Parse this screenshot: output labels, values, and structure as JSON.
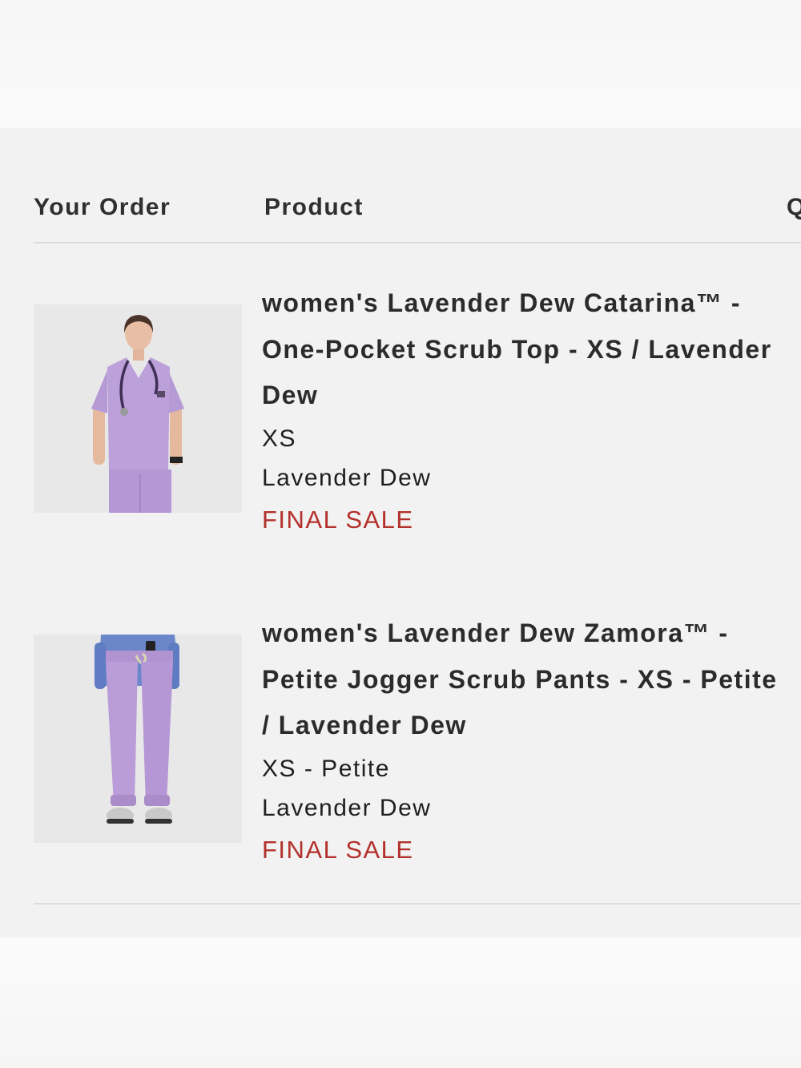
{
  "order_table": {
    "headers": {
      "your_order": "Your Order",
      "product": "Product",
      "quantity": "Q"
    },
    "items": [
      {
        "title": "women's Lavender Dew Catarina™ - One-Pocket Scrub Top - XS / Lavender Dew",
        "size": "XS",
        "color": "Lavender Dew",
        "sale_label": "FINAL SALE",
        "image_icon": "scrub-top-photo"
      },
      {
        "title": "women's Lavender Dew Zamora™ - Petite Jogger Scrub Pants - XS - Petite / Lavender Dew",
        "size": "XS - Petite",
        "color": "Lavender Dew",
        "sale_label": "FINAL SALE",
        "image_icon": "scrub-pants-photo"
      }
    ]
  },
  "colors": {
    "background": "#f2f2f2",
    "heading_text": "#2f2f2f",
    "final_sale": "#b3312c",
    "lavender": "#b89bd6",
    "divider": "#dddddd"
  }
}
